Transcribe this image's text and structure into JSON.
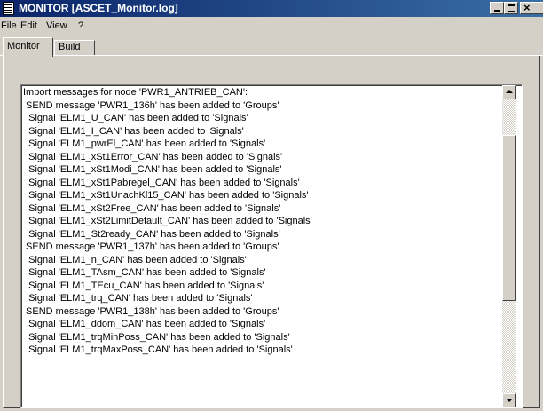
{
  "window": {
    "title": "MONITOR [ASCET_Monitor.log]"
  },
  "menu": [
    "File",
    "Edit",
    "View",
    "?"
  ],
  "tabs": [
    "Monitor",
    "Build"
  ],
  "log": [
    "Import messages for node 'PWR1_ANTRIEB_CAN':",
    " SEND message 'PWR1_136h' has been added to 'Groups'",
    "  Signal 'ELM1_U_CAN' has been added to 'Signals'",
    "  Signal 'ELM1_I_CAN' has been added to 'Signals'",
    "  Signal 'ELM1_pwrEl_CAN' has been added to 'Signals'",
    "  Signal 'ELM1_xSt1Error_CAN' has been added to 'Signals'",
    "  Signal 'ELM1_xSt1Modi_CAN' has been added to 'Signals'",
    "  Signal 'ELM1_xSt1Pabregel_CAN' has been added to 'Signals'",
    "  Signal 'ELM1_xSt1UnachKl15_CAN' has been added to 'Signals'",
    "  Signal 'ELM1_xSt2Free_CAN' has been added to 'Signals'",
    "  Signal 'ELM1_xSt2LimitDefault_CAN' has been added to 'Signals'",
    "  Signal 'ELM1_St2ready_CAN' has been added to 'Signals'",
    " SEND message 'PWR1_137h' has been added to 'Groups'",
    "  Signal 'ELM1_n_CAN' has been added to 'Signals'",
    "  Signal 'ELM1_TAsm_CAN' has been added to 'Signals'",
    "  Signal 'ELM1_TEcu_CAN' has been added to 'Signals'",
    "  Signal 'ELM1_trq_CAN' has been added to 'Signals'",
    " SEND message 'PWR1_138h' has been added to 'Groups'",
    "  Signal 'ELM1_ddom_CAN' has been added to 'Signals'",
    "  Signal 'ELM1_trqMinPoss_CAN' has been added to 'Signals'",
    "  Signal 'ELM1_trqMaxPoss_CAN' has been added to 'Signals'"
  ]
}
